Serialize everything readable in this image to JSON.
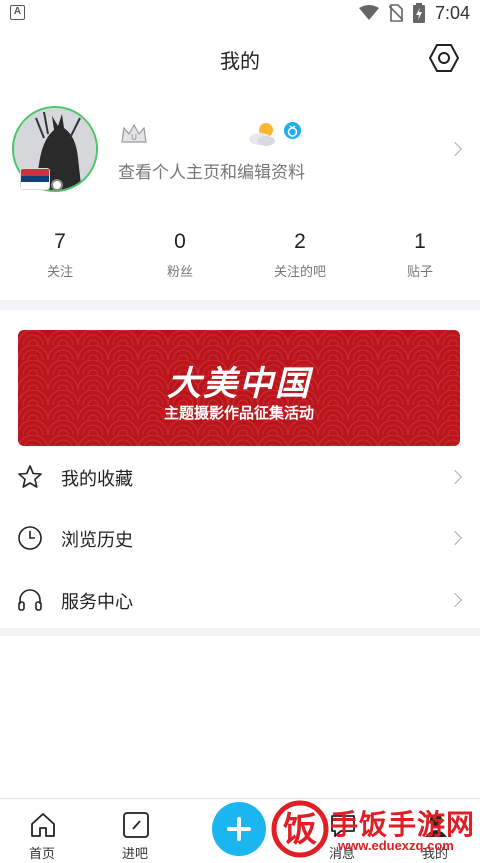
{
  "status_bar": {
    "time": "7:04",
    "left_icon_letter": "A"
  },
  "header": {
    "title": "我的"
  },
  "profile": {
    "subtitle": "查看个人主页和编辑资料"
  },
  "stats": [
    {
      "value": "7",
      "label": "关注"
    },
    {
      "value": "0",
      "label": "粉丝"
    },
    {
      "value": "2",
      "label": "关注的吧"
    },
    {
      "value": "1",
      "label": "贴子"
    }
  ],
  "banner": {
    "title": "大美中国",
    "subtitle": "主题摄影作品征集活动"
  },
  "menu": [
    {
      "label": "我的收藏",
      "icon": "star-icon"
    },
    {
      "label": "浏览历史",
      "icon": "clock-icon"
    },
    {
      "label": "服务中心",
      "icon": "headphones-icon"
    }
  ],
  "bottom_nav": [
    {
      "label": "首页",
      "icon": "home-icon"
    },
    {
      "label": "进吧",
      "icon": "edit-square-icon"
    },
    {
      "label": "消息",
      "icon": "message-icon"
    },
    {
      "label": "我的",
      "icon": "profile-icon"
    }
  ],
  "watermark": {
    "text": "手饭手游网",
    "url": "www.eduexzq.com",
    "glyph": "饭"
  },
  "colors": {
    "accent": "#1bb5f0",
    "banner_red": "#b8161c",
    "online_green": "#48c766",
    "watermark_red": "#e01e26"
  }
}
